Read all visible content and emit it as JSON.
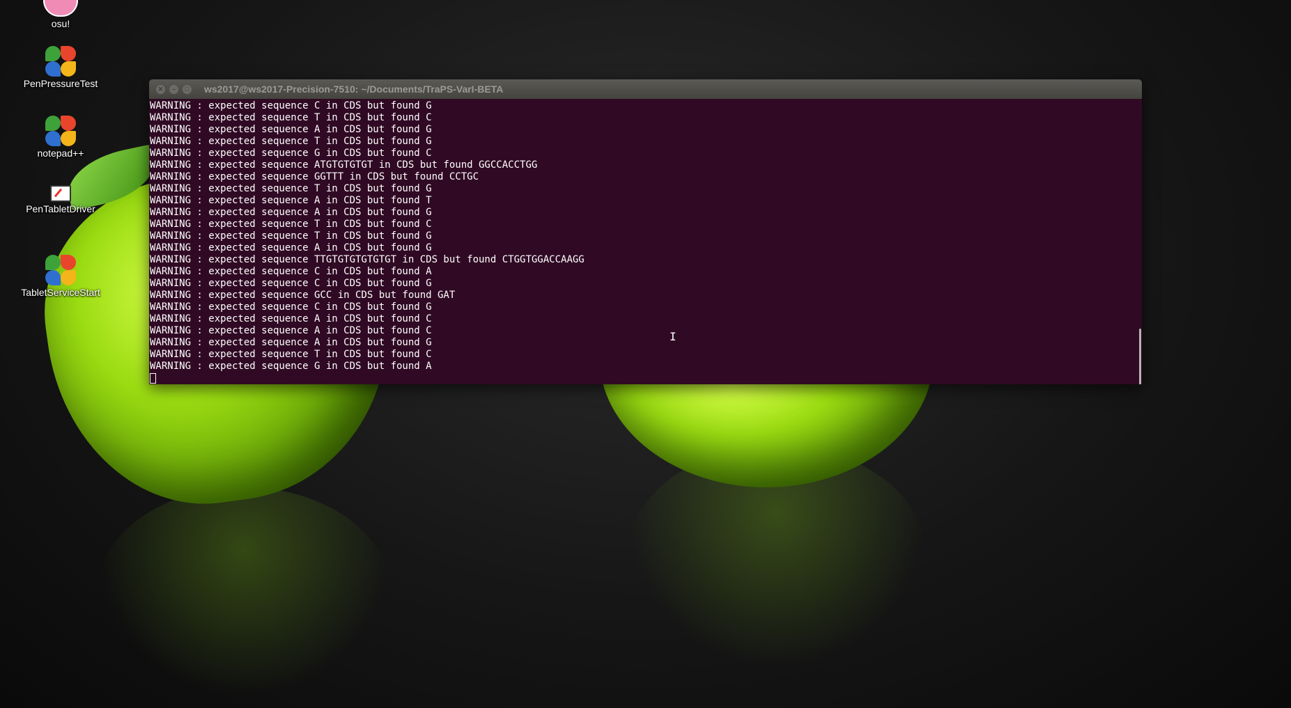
{
  "desktop": {
    "icons": [
      {
        "label": "osu!",
        "icon": "osu-icon"
      },
      {
        "label": "PenPressureTest",
        "icon": "clover-icon"
      },
      {
        "label": "notepad++",
        "icon": "clover-icon"
      },
      {
        "label": "PenTabletDriver",
        "icon": "tablet-driver-icon"
      },
      {
        "label": "TabletServiceStart",
        "icon": "clover-icon"
      }
    ]
  },
  "terminal": {
    "title": "ws2017@ws2017-Precision-7510: ~/Documents/TraPS-VarI-BETA",
    "background": "#300a24",
    "lines": [
      "WARNING : expected sequence C in CDS but found G",
      "WARNING : expected sequence T in CDS but found C",
      "WARNING : expected sequence A in CDS but found G",
      "WARNING : expected sequence T in CDS but found G",
      "WARNING : expected sequence G in CDS but found C",
      "WARNING : expected sequence ATGTGTGTGT in CDS but found GGCCACCTGG",
      "WARNING : expected sequence GGTTT in CDS but found CCTGC",
      "WARNING : expected sequence T in CDS but found G",
      "WARNING : expected sequence A in CDS but found T",
      "WARNING : expected sequence A in CDS but found G",
      "WARNING : expected sequence T in CDS but found C",
      "WARNING : expected sequence T in CDS but found G",
      "WARNING : expected sequence A in CDS but found G",
      "WARNING : expected sequence TTGTGTGTGTGTGT in CDS but found CTGGTGGACCAAGG",
      "WARNING : expected sequence C in CDS but found A",
      "WARNING : expected sequence C in CDS but found G",
      "WARNING : expected sequence GCC in CDS but found GAT",
      "WARNING : expected sequence C in CDS but found G",
      "WARNING : expected sequence A in CDS but found C",
      "WARNING : expected sequence A in CDS but found C",
      "WARNING : expected sequence A in CDS but found G",
      "WARNING : expected sequence T in CDS but found C",
      "WARNING : expected sequence G in CDS but found A"
    ]
  }
}
